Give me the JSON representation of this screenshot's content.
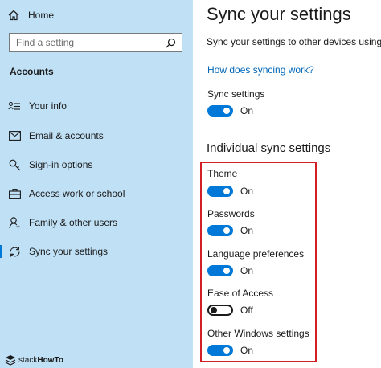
{
  "sidebar": {
    "home_label": "Home",
    "search_placeholder": "Find a setting",
    "section_label": "Accounts",
    "items": [
      {
        "label": "Your info",
        "icon": "person-card-icon"
      },
      {
        "label": "Email & accounts",
        "icon": "mail-icon"
      },
      {
        "label": "Sign-in options",
        "icon": "key-icon"
      },
      {
        "label": "Access work or school",
        "icon": "briefcase-icon"
      },
      {
        "label": "Family & other users",
        "icon": "person-add-icon"
      },
      {
        "label": "Sync your settings",
        "icon": "sync-icon",
        "active": true
      }
    ],
    "brand": {
      "prefix": "stack",
      "suffix": "HowTo"
    }
  },
  "main": {
    "title": "Sync your settings",
    "description": "Sync your settings to other devices using aimi",
    "help_link": "How does syncing work?",
    "sync_settings": {
      "label": "Sync settings",
      "state": "On",
      "enabled": true
    },
    "individual_heading": "Individual sync settings",
    "individual": [
      {
        "label": "Theme",
        "state": "On",
        "enabled": true
      },
      {
        "label": "Passwords",
        "state": "On",
        "enabled": true
      },
      {
        "label": "Language preferences",
        "state": "On",
        "enabled": true
      },
      {
        "label": "Ease of Access",
        "state": "Off",
        "enabled": false
      },
      {
        "label": "Other Windows settings",
        "state": "On",
        "enabled": true
      }
    ]
  },
  "colors": {
    "sidebar_bg": "#bfe0f5",
    "accent": "#0078d7",
    "link": "#0067b8",
    "highlight": "#d21f26"
  }
}
